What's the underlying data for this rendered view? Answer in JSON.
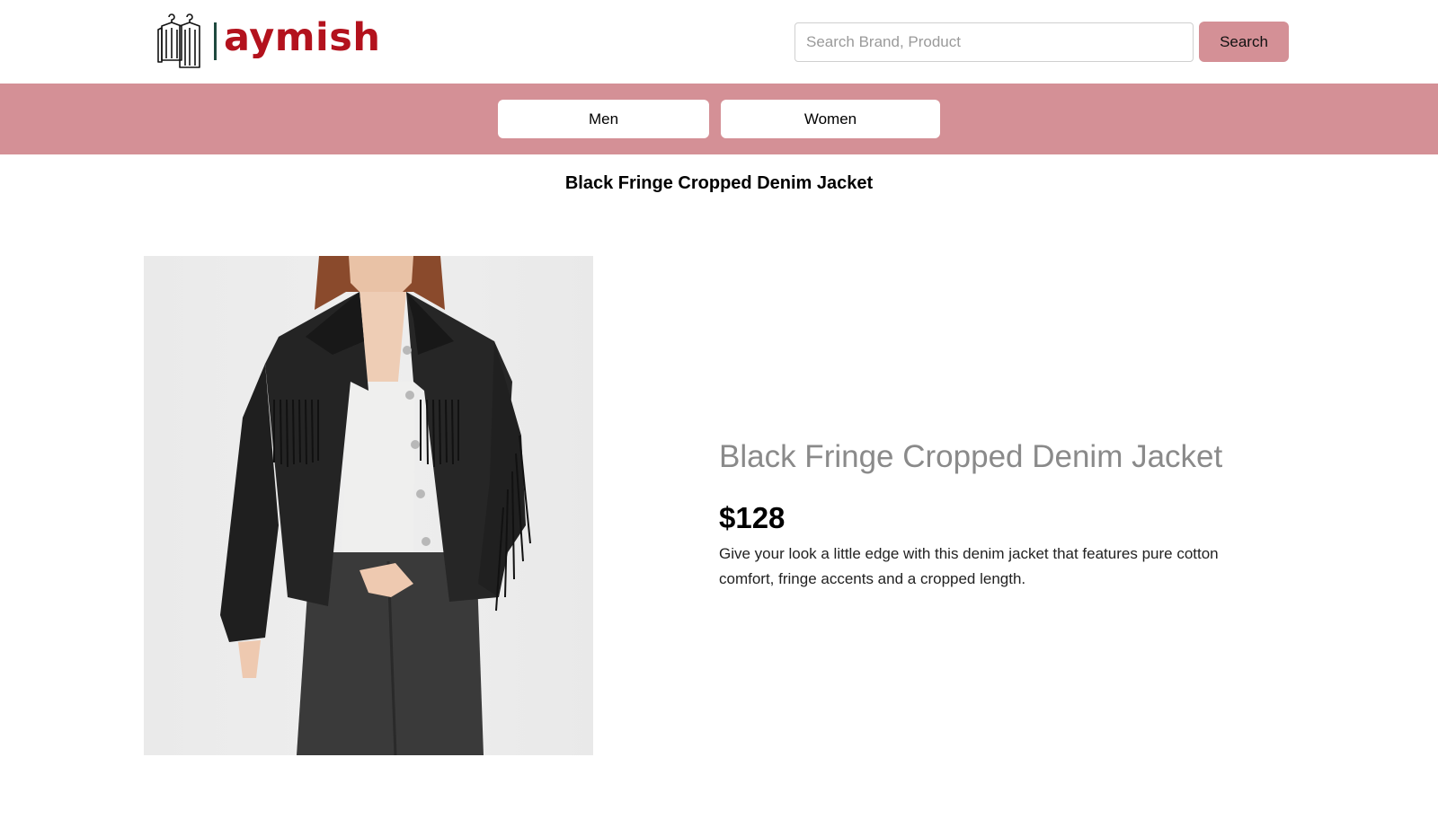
{
  "brand": {
    "name": "aymish",
    "color": "#b3121d",
    "accent": "#d49096"
  },
  "search": {
    "placeholder": "Search Brand, Product",
    "value": "",
    "button_label": "Search"
  },
  "nav": {
    "items": [
      {
        "label": "Men"
      },
      {
        "label": "Women"
      }
    ]
  },
  "page": {
    "title": "Black Fringe Cropped Denim Jacket"
  },
  "product": {
    "image_icon": "product-photo",
    "name": "Black Fringe Cropped Denim Jacket",
    "price": "$128",
    "description": "Give your look a little edge with this denim jacket that features pure cotton comfort, fringe accents and a cropped length."
  }
}
